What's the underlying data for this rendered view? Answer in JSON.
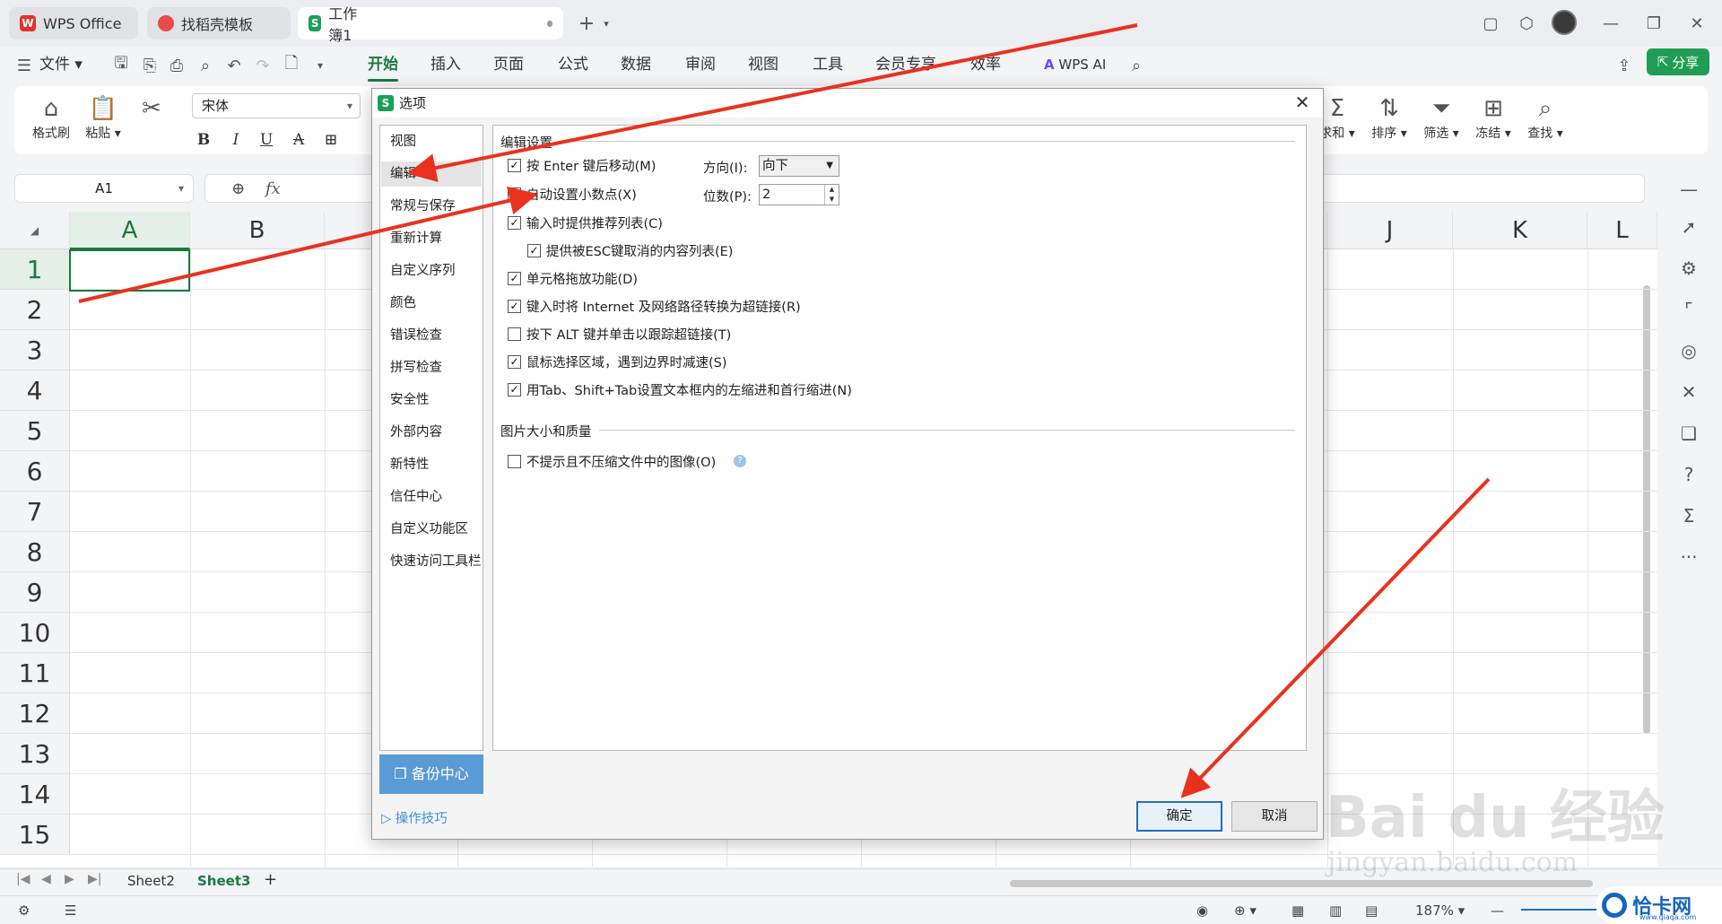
{
  "tabs": [
    {
      "label": "WPS Office",
      "logo": "W",
      "active": false
    },
    {
      "label": "找稻壳模板",
      "logo": "",
      "active": false
    },
    {
      "label": "工作簿1",
      "logo": "S",
      "active": true
    }
  ],
  "menubar": {
    "file_label": "文件",
    "items": [
      "开始",
      "插入",
      "页面",
      "公式",
      "数据",
      "审阅",
      "视图",
      "工具",
      "会员专享",
      "效率"
    ],
    "active_item": "开始",
    "wps_ai_label": "WPS AI",
    "share_label": "分享"
  },
  "ribbon": {
    "format_painter": "格式刷",
    "paste": "粘贴",
    "font_name": "宋体",
    "bold": "B",
    "italic": "I",
    "underline": "U",
    "strikethrough": "A",
    "sum": "求和",
    "sort": "排序",
    "filter": "筛选",
    "freeze": "冻结",
    "find": "查找"
  },
  "formula_bar": {
    "cell_ref": "A1",
    "fx": "fx"
  },
  "grid": {
    "columns": [
      "A",
      "B",
      "J",
      "K",
      "L"
    ],
    "rows": [
      "1",
      "2",
      "3",
      "4",
      "5",
      "6",
      "7",
      "8",
      "9",
      "10",
      "11",
      "12",
      "13",
      "14",
      "15"
    ],
    "selected_cell": "A1"
  },
  "sheets": {
    "tabs": [
      "Sheet2",
      "Sheet3"
    ],
    "active": "Sheet3",
    "add_label": "+"
  },
  "statusbar": {
    "zoom": "187%"
  },
  "dialog": {
    "title": "选项",
    "nav_items": [
      "视图",
      "编辑",
      "常规与保存",
      "重新计算",
      "自定义序列",
      "颜色",
      "错误检查",
      "拼写检查",
      "安全性",
      "外部内容",
      "新特性",
      "信任中心",
      "自定义功能区",
      "快速访问工具栏"
    ],
    "selected_nav": "编辑",
    "backup_label": "备份中心",
    "tips_label": "操作技巧",
    "section_edit": "编辑设置",
    "section_image": "图片大小和质量",
    "options": [
      {
        "label": "按 Enter 键后移动(M)",
        "checked": true
      },
      {
        "label": "自动设置小数点(X)",
        "checked": true
      },
      {
        "label": "输入时提供推荐列表(C)",
        "checked": true
      },
      {
        "label": "提供被ESC键取消的内容列表(E)",
        "checked": true
      },
      {
        "label": "单元格拖放功能(D)",
        "checked": true
      },
      {
        "label": "键入时将 Internet 及网络路径转换为超链接(R)",
        "checked": true
      },
      {
        "label": "按下 ALT 键并单击以跟踪超链接(T)",
        "checked": false
      },
      {
        "label": "鼠标选择区域，遇到边界时减速(S)",
        "checked": true
      },
      {
        "label": "用Tab、Shift+Tab设置文本框内的左缩进和首行缩进(N)",
        "checked": true
      }
    ],
    "image_option": {
      "label": "不提示且不压缩文件中的图像(O)",
      "checked": false
    },
    "direction_label": "方向(I):",
    "direction_value": "向下",
    "places_label": "位数(P):",
    "places_value": "2",
    "ok_label": "确定",
    "cancel_label": "取消"
  },
  "watermarks": {
    "baidu": "Bai du 经验",
    "url": "jingyan.baidu.com",
    "badge": "恰卡网",
    "badge_sub": "www.qiaqa.com"
  },
  "colors": {
    "accent_green": "#1b7a3f",
    "arrow_red": "#e8321f",
    "dialog_blue": "#5b9bd5"
  }
}
